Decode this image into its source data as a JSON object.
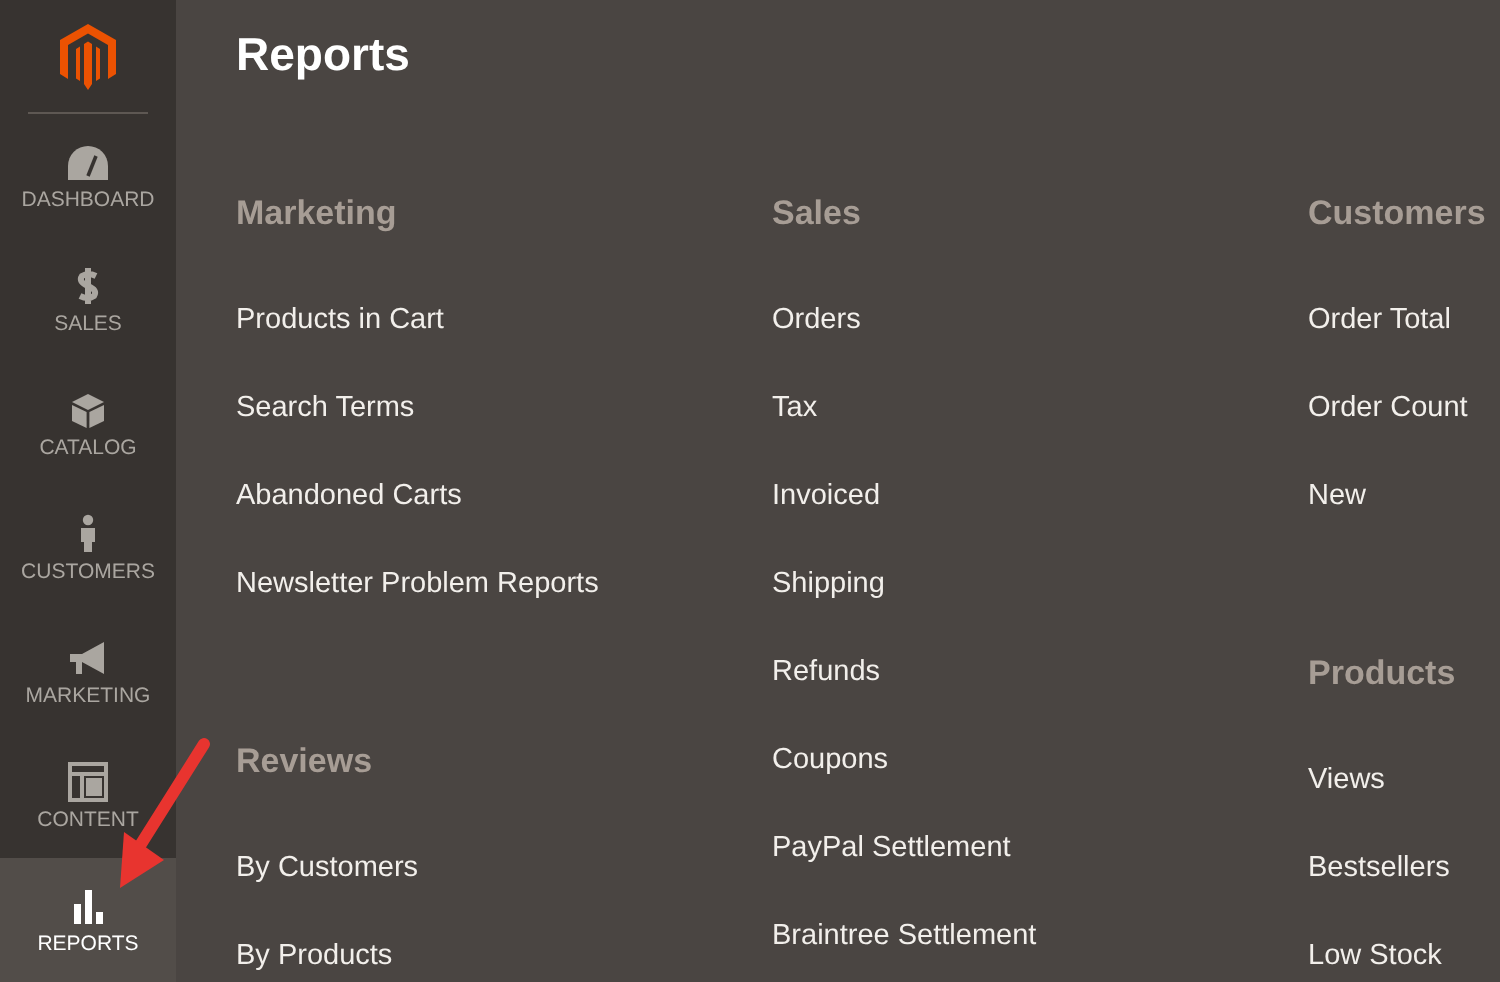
{
  "sidebar": {
    "items": [
      {
        "kind": "dashboard",
        "label": "DASHBOARD",
        "selected": false
      },
      {
        "kind": "sales",
        "label": "SALES",
        "selected": false
      },
      {
        "kind": "catalog",
        "label": "CATALOG",
        "selected": false
      },
      {
        "kind": "customers",
        "label": "CUSTOMERS",
        "selected": false
      },
      {
        "kind": "marketing",
        "label": "MARKETING",
        "selected": false
      },
      {
        "kind": "content",
        "label": "CONTENT",
        "selected": false
      },
      {
        "kind": "reports",
        "label": "REPORTS",
        "selected": true
      }
    ]
  },
  "page_title": "Reports",
  "columns": [
    [
      {
        "heading": "Marketing",
        "links": [
          "Products in Cart",
          "Search Terms",
          "Abandoned Carts",
          "Newsletter Problem Reports"
        ]
      },
      {
        "heading": "Reviews",
        "links": [
          "By Customers",
          "By Products"
        ]
      }
    ],
    [
      {
        "heading": "Sales",
        "links": [
          "Orders",
          "Tax",
          "Invoiced",
          "Shipping",
          "Refunds",
          "Coupons",
          "PayPal Settlement",
          "Braintree Settlement"
        ]
      }
    ],
    [
      {
        "heading": "Customers",
        "links": [
          "Order Total",
          "Order Count",
          "New"
        ]
      },
      {
        "heading": "Products",
        "links": [
          "Views",
          "Bestsellers",
          "Low Stock"
        ]
      }
    ]
  ]
}
